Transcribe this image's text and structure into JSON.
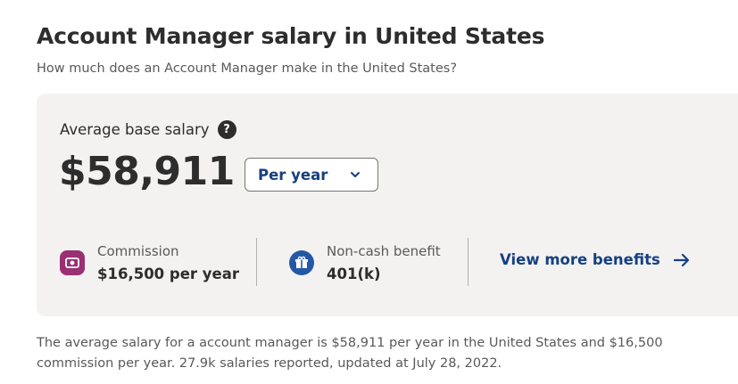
{
  "header": {
    "title": "Account Manager salary in United States",
    "subtitle": "How much does an Account Manager make in the United States?"
  },
  "salary_card": {
    "average_label": "Average base salary",
    "help_icon": "question-circle-icon",
    "help_glyph": "?",
    "amount": "$58,911",
    "period_select": {
      "selected": "Per year",
      "icon": "chevron-down-icon"
    },
    "benefits": [
      {
        "icon": "money-icon",
        "name": "Commission",
        "value": "$16,500 per year",
        "icon_color": "#9b2f73"
      },
      {
        "icon": "gift-icon",
        "name": "Non-cash benefit",
        "value": "401(k)",
        "icon_color": "#2557a7"
      }
    ],
    "view_more": {
      "label": "View more benefits",
      "icon": "arrow-right-icon"
    }
  },
  "footnote": "The average salary for a account manager is $58,911 per year in the United States and $16,500 commission per year. 27.9k salaries reported, updated at July 28, 2022.",
  "colors": {
    "link": "#164081",
    "card_bg": "#f3f2f1",
    "text": "#2d2d2d",
    "muted": "#595959"
  }
}
